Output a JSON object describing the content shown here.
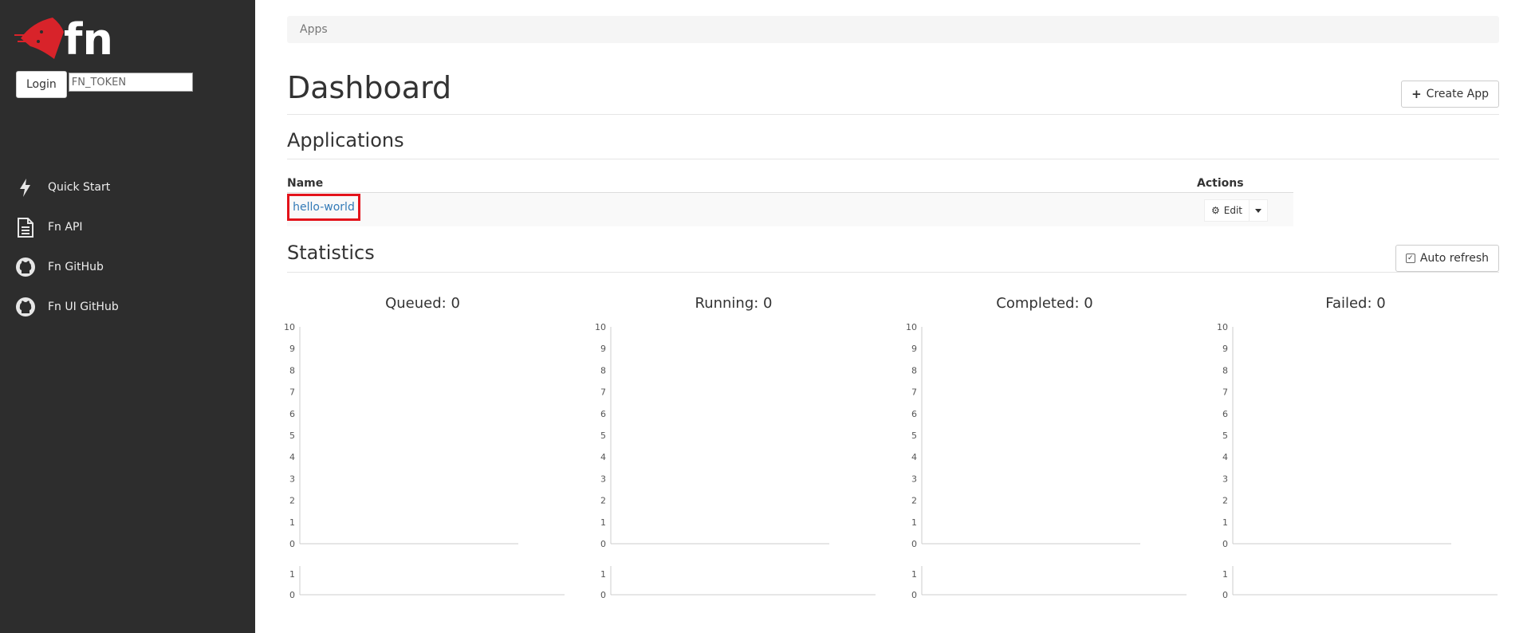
{
  "sidebar": {
    "login_label": "Login",
    "token_value": "FN_TOKEN",
    "nav": [
      {
        "label": "Quick Start",
        "icon": "lightning-icon"
      },
      {
        "label": "Fn API",
        "icon": "document-icon"
      },
      {
        "label": "Fn GitHub",
        "icon": "github-icon"
      },
      {
        "label": "Fn UI GitHub",
        "icon": "github-icon"
      }
    ]
  },
  "breadcrumb": {
    "label": "Apps"
  },
  "page": {
    "title": "Dashboard",
    "create_label": "Create App"
  },
  "applications": {
    "title": "Applications",
    "col_name": "Name",
    "col_actions": "Actions",
    "rows": [
      {
        "name": "hello-world",
        "edit_label": "Edit"
      }
    ]
  },
  "statistics": {
    "title": "Statistics",
    "auto_refresh_label": "Auto refresh",
    "auto_refresh_checked": true
  },
  "colors": {
    "sidebar_bg": "#2d2d2d",
    "link": "#337ab7",
    "highlight": "#e3131b",
    "logo_red": "#d8232a"
  },
  "chart_data": [
    {
      "type": "line",
      "title": "Queued: 0",
      "ylim": [
        0,
        10
      ],
      "yticks": [
        0,
        1,
        2,
        3,
        4,
        5,
        6,
        7,
        8,
        9,
        10
      ],
      "y2ticks": [
        0,
        1
      ],
      "values": []
    },
    {
      "type": "line",
      "title": "Running: 0",
      "ylim": [
        0,
        10
      ],
      "yticks": [
        0,
        1,
        2,
        3,
        4,
        5,
        6,
        7,
        8,
        9,
        10
      ],
      "y2ticks": [
        0,
        1
      ],
      "values": []
    },
    {
      "type": "line",
      "title": "Completed: 0",
      "ylim": [
        0,
        10
      ],
      "yticks": [
        0,
        1,
        2,
        3,
        4,
        5,
        6,
        7,
        8,
        9,
        10
      ],
      "y2ticks": [
        0,
        1
      ],
      "values": []
    },
    {
      "type": "line",
      "title": "Failed: 0",
      "ylim": [
        0,
        10
      ],
      "yticks": [
        0,
        1,
        2,
        3,
        4,
        5,
        6,
        7,
        8,
        9,
        10
      ],
      "y2ticks": [
        0,
        1
      ],
      "values": []
    }
  ]
}
